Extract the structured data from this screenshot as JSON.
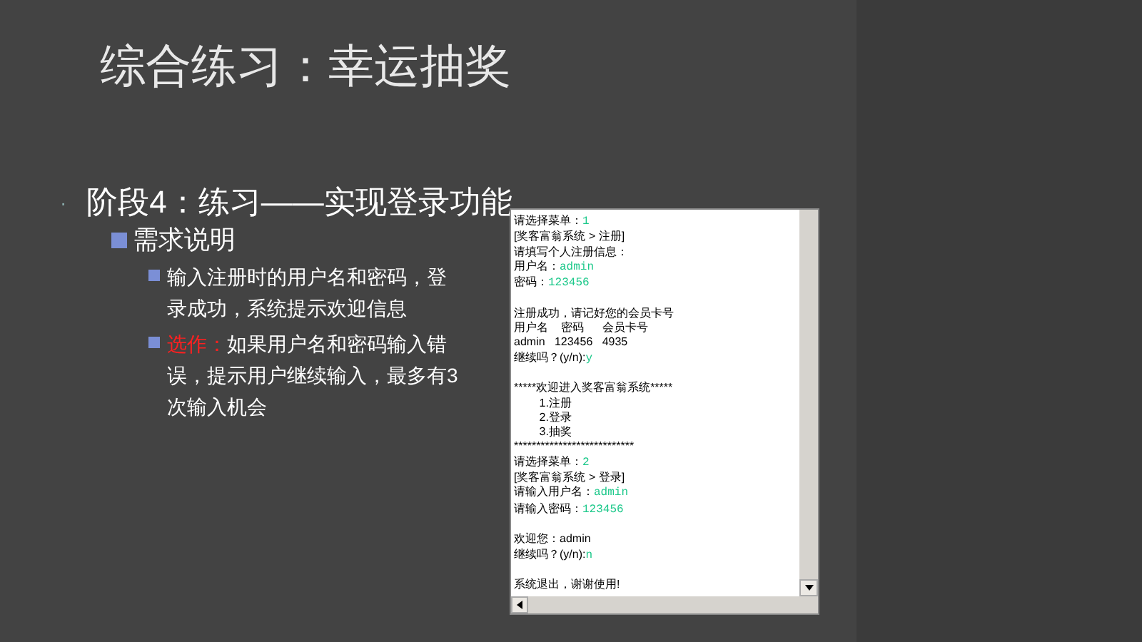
{
  "slide": {
    "title": "综合练习：幸运抽奖",
    "bullet": {
      "marker": "·",
      "text": "阶段4：练习——实现登录功能",
      "sub": {
        "text": "需求说明",
        "items": [
          {
            "text": "输入注册时的用户名和密码，登录成功，系统提示欢迎信息"
          },
          {
            "highlight": "选作：",
            "text": "如果用户名和密码输入错误，提示用户继续输入，最多有3次输入机会"
          }
        ]
      }
    }
  },
  "console": {
    "lines": [
      {
        "kind": "text",
        "text": "请选择菜单：",
        "input": "1"
      },
      {
        "kind": "text",
        "text": "[奖客富翁系统 > 注册]"
      },
      {
        "kind": "text",
        "text": "请填写个人注册信息："
      },
      {
        "kind": "text",
        "text": "用户名：",
        "input": "admin"
      },
      {
        "kind": "text",
        "text": "密码：",
        "input": "123456"
      },
      {
        "kind": "blank"
      },
      {
        "kind": "text",
        "text": "注册成功，请记好您的会员卡号"
      },
      {
        "kind": "text",
        "text": "用户名    密码      会员卡号"
      },
      {
        "kind": "text",
        "text": "admin   123456   4935"
      },
      {
        "kind": "text",
        "text": "继续吗？(y/n):",
        "input": "y"
      },
      {
        "kind": "blank"
      },
      {
        "kind": "text",
        "text": "*****欢迎进入奖客富翁系统*****"
      },
      {
        "kind": "text",
        "text": "        1.注册"
      },
      {
        "kind": "text",
        "text": "        2.登录"
      },
      {
        "kind": "text",
        "text": "        3.抽奖"
      },
      {
        "kind": "text",
        "text": "***************************"
      },
      {
        "kind": "text",
        "text": "请选择菜单：",
        "input": "2"
      },
      {
        "kind": "text",
        "text": "[奖客富翁系统 > 登录]"
      },
      {
        "kind": "text",
        "text": "请输入用户名：",
        "input": "admin"
      },
      {
        "kind": "text",
        "text": "请输入密码：",
        "input": "123456"
      },
      {
        "kind": "blank"
      },
      {
        "kind": "text",
        "text": "欢迎您：admin"
      },
      {
        "kind": "text",
        "text": "继续吗？(y/n):",
        "input": "n"
      },
      {
        "kind": "blank"
      },
      {
        "kind": "text",
        "text": "系统退出，谢谢使用!"
      }
    ]
  }
}
